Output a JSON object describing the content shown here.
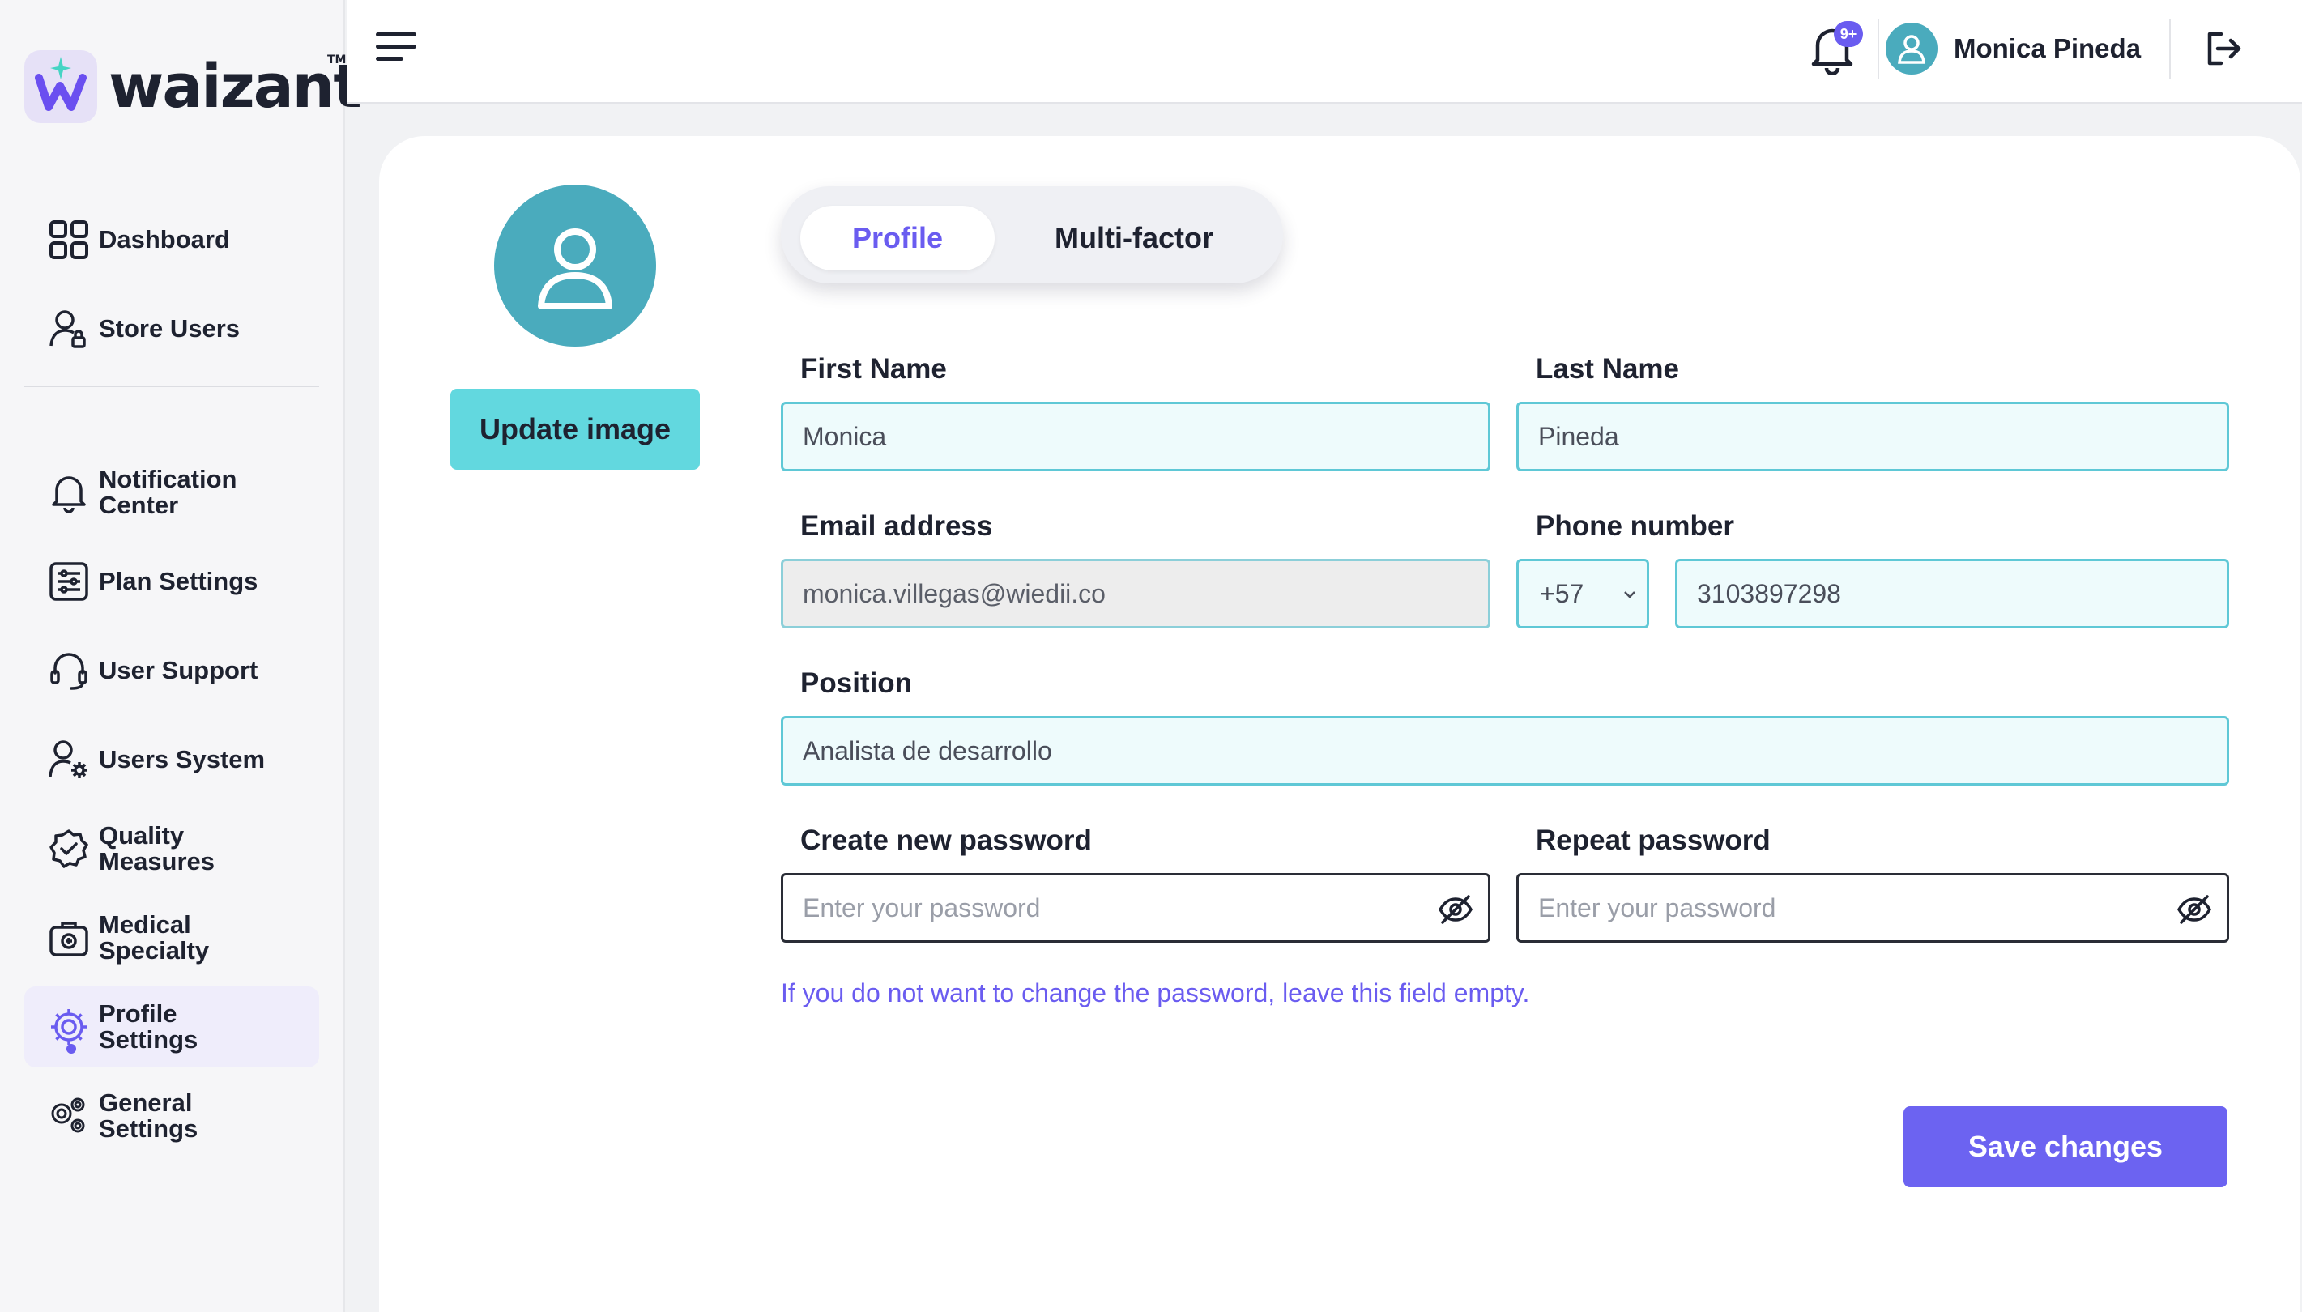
{
  "brand": {
    "name": "waizant",
    "tm": "TM",
    "accent": "#6a5cf0",
    "teal": "#4aabbd"
  },
  "sidebar": {
    "items": [
      {
        "label": "Dashboard",
        "icon": "grid-icon"
      },
      {
        "label": "Store Users",
        "icon": "user-lock-icon"
      },
      {
        "label": "Notification Center",
        "icon": "bell-icon"
      },
      {
        "label": "Plan Settings",
        "icon": "sliders-icon"
      },
      {
        "label": "User Support",
        "icon": "headset-icon"
      },
      {
        "label": "Users System",
        "icon": "user-gear-icon"
      },
      {
        "label": "Quality Measures",
        "icon": "badge-check-icon"
      },
      {
        "label": "Medical Specialty",
        "icon": "medical-bag-icon"
      },
      {
        "label": "Profile Settings",
        "icon": "gear-icon",
        "active": true
      },
      {
        "label": "General Settings",
        "icon": "gears-icon"
      }
    ]
  },
  "header": {
    "notification_badge": "9+",
    "user_name": "Monica Pineda"
  },
  "profile": {
    "update_image_label": "Update image",
    "tabs": [
      {
        "label": "Profile",
        "active": true
      },
      {
        "label": "Multi-factor",
        "active": false
      }
    ],
    "first_name": {
      "label": "First Name",
      "value": "Monica"
    },
    "last_name": {
      "label": "Last Name",
      "value": "Pineda"
    },
    "email": {
      "label": "Email address",
      "value": "monica.villegas@wiedii.co"
    },
    "phone": {
      "label": "Phone number",
      "code": "+57",
      "value": "3103897298"
    },
    "position": {
      "label": "Position",
      "value": "Analista de desarrollo"
    },
    "new_password": {
      "label": "Create new password",
      "placeholder": "Enter your password"
    },
    "repeat_password": {
      "label": "Repeat password",
      "placeholder": "Enter your password"
    },
    "hint": "If you do not want to change the password, leave this field empty.",
    "save_label": "Save changes"
  }
}
